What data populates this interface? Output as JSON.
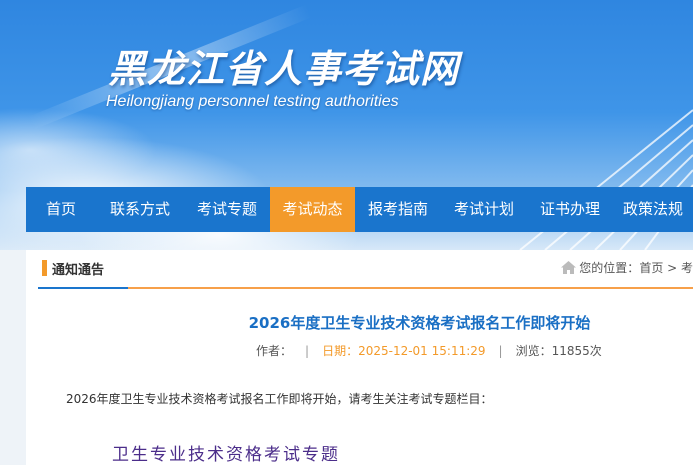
{
  "header": {
    "title": "黑龙江省人事考试网",
    "subtitle": "Heilongjiang personnel testing authorities"
  },
  "nav": {
    "items": [
      {
        "label": "首页"
      },
      {
        "label": "联系方式"
      },
      {
        "label": "考试专题"
      },
      {
        "label": "考试动态",
        "active": true
      },
      {
        "label": "报考指南"
      },
      {
        "label": "考试计划"
      },
      {
        "label": "证书办理"
      },
      {
        "label": "政策法规"
      }
    ],
    "active_color": "#f39a2a",
    "bar_color": "#1a75cd"
  },
  "section": {
    "title": "通知通告",
    "location_label": "您的位置：",
    "location_path": "首页 > 考",
    "home_icon": "home-icon"
  },
  "article": {
    "title": "2026年度卫生专业技术资格考试报名工作即将开始",
    "author_label": "作者：",
    "date_label": "日期：",
    "date_value": "2025-12-01 15:11:29",
    "views_label": "浏览：",
    "views_value": "11855次",
    "body": "2026年度卫生专业技术资格考试报名工作即将开始，请考生关注考试专题栏目：",
    "topic_link": "卫生专业技术资格考试专题"
  }
}
